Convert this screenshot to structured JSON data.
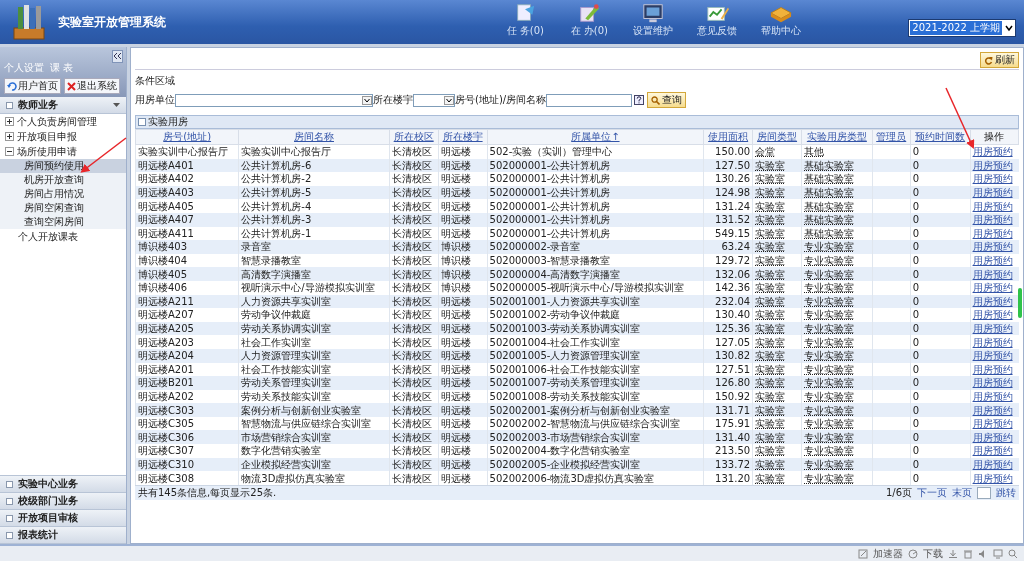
{
  "header": {
    "title": "实验室开放管理系统",
    "nav": [
      {
        "kind": "tasks",
        "label": "任 务(0)"
      },
      {
        "kind": "doing",
        "label": "在 办(0)"
      },
      {
        "kind": "settings",
        "label": "设置维护"
      },
      {
        "kind": "feedback",
        "label": "意见反馈"
      },
      {
        "kind": "help",
        "label": "帮助中心"
      }
    ],
    "semester": "2021-2022 上学期"
  },
  "sidebar": {
    "user_links": [
      "个人设置",
      "课 表"
    ],
    "buttons": [
      {
        "kind": "home",
        "label": "用户首页"
      },
      {
        "kind": "exit",
        "label": "退出系统"
      }
    ],
    "groups": [
      {
        "label": "教师业务",
        "expanded": true,
        "items": [
          {
            "label": "个人负责房间管理",
            "expanded": false
          },
          {
            "label": "开放项目申报",
            "expanded": false
          },
          {
            "label": "场所使用申请",
            "expanded": true,
            "children": [
              {
                "label": "房间预约使用",
                "selected": true
              },
              {
                "label": "机房开放查询",
                "selected": false
              },
              {
                "label": "房间占用情况",
                "selected": false
              },
              {
                "label": "房间空闲查询",
                "selected": false
              },
              {
                "label": "查询空闲房间",
                "selected": false
              }
            ]
          },
          {
            "label": "个人开放课表"
          }
        ]
      },
      {
        "label": "实验中心业务",
        "expanded": false
      },
      {
        "label": "校级部门业务",
        "expanded": false
      },
      {
        "label": "开放项目审核",
        "expanded": false
      },
      {
        "label": "报表统计",
        "expanded": false
      }
    ]
  },
  "main": {
    "refresh_button": "刷新",
    "filter": {
      "legend": "条件区域",
      "unit_label": "用房单位",
      "building_label": "所在楼宇",
      "keyword_label": "房号(地址)/房间名称",
      "search_button": "查询"
    },
    "panel_title": "实验用房",
    "table": {
      "columns": [
        {
          "label": "房号(地址)",
          "sortable": true
        },
        {
          "label": "房间名称",
          "sortable": true
        },
        {
          "label": "所在校区",
          "sortable": true
        },
        {
          "label": "所在楼宇",
          "sortable": true
        },
        {
          "label": "所属单位↑",
          "sortable": true
        },
        {
          "label": "使用面积",
          "sortable": true
        },
        {
          "label": "房间类型",
          "sortable": true
        },
        {
          "label": "实验用房类型",
          "sortable": true
        },
        {
          "label": "管理员",
          "sortable": true
        },
        {
          "label": "预约时间数",
          "sortable": true
        },
        {
          "label": "操作",
          "sortable": false
        }
      ],
      "rows": [
        {
          "room": "实验实训中心报告厅",
          "name": "实验实训中心报告厅",
          "campus": "长清校区",
          "building": "明远楼",
          "unit": "502-实验（实训）管理中心",
          "area": "150.00",
          "room_type": "会堂",
          "lab_type": "其他",
          "bookings": "0",
          "action": "用房预约"
        },
        {
          "room": "明远楼A401",
          "name": "公共计算机房-6",
          "campus": "长清校区",
          "building": "明远楼",
          "unit": "502000001-公共计算机房",
          "area": "127.50",
          "room_type": "实验室",
          "lab_type": "基础实验室",
          "bookings": "0",
          "action": "用房预约"
        },
        {
          "room": "明远楼A402",
          "name": "公共计算机房-2",
          "campus": "长清校区",
          "building": "明远楼",
          "unit": "502000001-公共计算机房",
          "area": "130.26",
          "room_type": "实验室",
          "lab_type": "基础实验室",
          "bookings": "0",
          "action": "用房预约"
        },
        {
          "room": "明远楼A403",
          "name": "公共计算机房-5",
          "campus": "长清校区",
          "building": "明远楼",
          "unit": "502000001-公共计算机房",
          "area": "124.98",
          "room_type": "实验室",
          "lab_type": "基础实验室",
          "bookings": "0",
          "action": "用房预约"
        },
        {
          "room": "明远楼A405",
          "name": "公共计算机房-4",
          "campus": "长清校区",
          "building": "明远楼",
          "unit": "502000001-公共计算机房",
          "area": "131.24",
          "room_type": "实验室",
          "lab_type": "基础实验室",
          "bookings": "0",
          "action": "用房预约"
        },
        {
          "room": "明远楼A407",
          "name": "公共计算机房-3",
          "campus": "长清校区",
          "building": "明远楼",
          "unit": "502000001-公共计算机房",
          "area": "131.52",
          "room_type": "实验室",
          "lab_type": "基础实验室",
          "bookings": "0",
          "action": "用房预约"
        },
        {
          "room": "明远楼A411",
          "name": "公共计算机房-1",
          "campus": "长清校区",
          "building": "明远楼",
          "unit": "502000001-公共计算机房",
          "area": "549.15",
          "room_type": "实验室",
          "lab_type": "基础实验室",
          "bookings": "0",
          "action": "用房预约"
        },
        {
          "room": "博识楼403",
          "name": "录音室",
          "campus": "长清校区",
          "building": "博识楼",
          "unit": "502000002-录音室",
          "area": "63.24",
          "room_type": "实验室",
          "lab_type": "专业实验室",
          "bookings": "0",
          "action": "用房预约"
        },
        {
          "room": "博识楼404",
          "name": "智慧录播教室",
          "campus": "长清校区",
          "building": "博识楼",
          "unit": "502000003-智慧录播教室",
          "area": "129.72",
          "room_type": "实验室",
          "lab_type": "专业实验室",
          "bookings": "0",
          "action": "用房预约"
        },
        {
          "room": "博识楼405",
          "name": "高清数字演播室",
          "campus": "长清校区",
          "building": "博识楼",
          "unit": "502000004-高清数字演播室",
          "area": "132.06",
          "room_type": "实验室",
          "lab_type": "专业实验室",
          "bookings": "0",
          "action": "用房预约"
        },
        {
          "room": "博识楼406",
          "name": "视听演示中心/导游模拟实训室",
          "campus": "长清校区",
          "building": "博识楼",
          "unit": "502000005-视听演示中心/导游模拟实训室",
          "area": "142.36",
          "room_type": "实验室",
          "lab_type": "专业实验室",
          "bookings": "0",
          "action": "用房预约"
        },
        {
          "room": "明远楼A211",
          "name": "人力资源共享实训室",
          "campus": "长清校区",
          "building": "明远楼",
          "unit": "502001001-人力资源共享实训室",
          "area": "232.04",
          "room_type": "实验室",
          "lab_type": "专业实验室",
          "bookings": "0",
          "action": "用房预约"
        },
        {
          "room": "明远楼A207",
          "name": "劳动争议仲裁庭",
          "campus": "长清校区",
          "building": "明远楼",
          "unit": "502001002-劳动争议仲裁庭",
          "area": "130.40",
          "room_type": "实验室",
          "lab_type": "专业实验室",
          "bookings": "0",
          "action": "用房预约"
        },
        {
          "room": "明远楼A205",
          "name": "劳动关系协调实训室",
          "campus": "长清校区",
          "building": "明远楼",
          "unit": "502001003-劳动关系协调实训室",
          "area": "125.36",
          "room_type": "实验室",
          "lab_type": "专业实验室",
          "bookings": "0",
          "action": "用房预约"
        },
        {
          "room": "明远楼A203",
          "name": "社会工作实训室",
          "campus": "长清校区",
          "building": "明远楼",
          "unit": "502001004-社会工作实训室",
          "area": "127.05",
          "room_type": "实验室",
          "lab_type": "专业实验室",
          "bookings": "0",
          "action": "用房预约"
        },
        {
          "room": "明远楼A204",
          "name": "人力资源管理实训室",
          "campus": "长清校区",
          "building": "明远楼",
          "unit": "502001005-人力资源管理实训室",
          "area": "130.82",
          "room_type": "实验室",
          "lab_type": "专业实验室",
          "bookings": "0",
          "action": "用房预约"
        },
        {
          "room": "明远楼A201",
          "name": "社会工作技能实训室",
          "campus": "长清校区",
          "building": "明远楼",
          "unit": "502001006-社会工作技能实训室",
          "area": "127.51",
          "room_type": "实验室",
          "lab_type": "专业实验室",
          "bookings": "0",
          "action": "用房预约"
        },
        {
          "room": "明远楼B201",
          "name": "劳动关系管理实训室",
          "campus": "长清校区",
          "building": "明远楼",
          "unit": "502001007-劳动关系管理实训室",
          "area": "126.80",
          "room_type": "实验室",
          "lab_type": "专业实验室",
          "bookings": "0",
          "action": "用房预约"
        },
        {
          "room": "明远楼A202",
          "name": "劳动关系技能实训室",
          "campus": "长清校区",
          "building": "明远楼",
          "unit": "502001008-劳动关系技能实训室",
          "area": "150.92",
          "room_type": "实验室",
          "lab_type": "专业实验室",
          "bookings": "0",
          "action": "用房预约"
        },
        {
          "room": "明远楼C303",
          "name": "案例分析与创新创业实验室",
          "campus": "长清校区",
          "building": "明远楼",
          "unit": "502002001-案例分析与创新创业实验室",
          "area": "131.71",
          "room_type": "实验室",
          "lab_type": "专业实验室",
          "bookings": "0",
          "action": "用房预约"
        },
        {
          "room": "明远楼C305",
          "name": "智慧物流与供应链综合实训室",
          "campus": "长清校区",
          "building": "明远楼",
          "unit": "502002002-智慧物流与供应链综合实训室",
          "area": "175.91",
          "room_type": "实验室",
          "lab_type": "专业实验室",
          "bookings": "0",
          "action": "用房预约"
        },
        {
          "room": "明远楼C306",
          "name": "市场营销综合实训室",
          "campus": "长清校区",
          "building": "明远楼",
          "unit": "502002003-市场营销综合实训室",
          "area": "131.40",
          "room_type": "实验室",
          "lab_type": "专业实验室",
          "bookings": "0",
          "action": "用房预约"
        },
        {
          "room": "明远楼C307",
          "name": "数字化营销实验室",
          "campus": "长清校区",
          "building": "明远楼",
          "unit": "502002004-数字化营销实验室",
          "area": "213.50",
          "room_type": "实验室",
          "lab_type": "专业实验室",
          "bookings": "0",
          "action": "用房预约"
        },
        {
          "room": "明远楼C310",
          "name": "企业模拟经营实训室",
          "campus": "长清校区",
          "building": "明远楼",
          "unit": "502002005-企业模拟经营实训室",
          "area": "133.72",
          "room_type": "实验室",
          "lab_type": "专业实验室",
          "bookings": "0",
          "action": "用房预约"
        },
        {
          "room": "明远楼C308",
          "name": "物流3D虚拟仿真实验室",
          "campus": "长清校区",
          "building": "明远楼",
          "unit": "502002006-物流3D虚拟仿真实验室",
          "area": "131.20",
          "room_type": "实验室",
          "lab_type": "专业实验室",
          "bookings": "0",
          "action": "用房预约"
        }
      ]
    },
    "summary": "共有145条信息,每页显示25条.",
    "pagination": {
      "page": "1/6页",
      "next": "下一页",
      "last": "末页",
      "go": "跳转"
    }
  },
  "status_bar": {
    "items": [
      {
        "kind": "accelerator",
        "label": "加速器"
      },
      {
        "kind": "download",
        "label": "下载"
      }
    ]
  }
}
